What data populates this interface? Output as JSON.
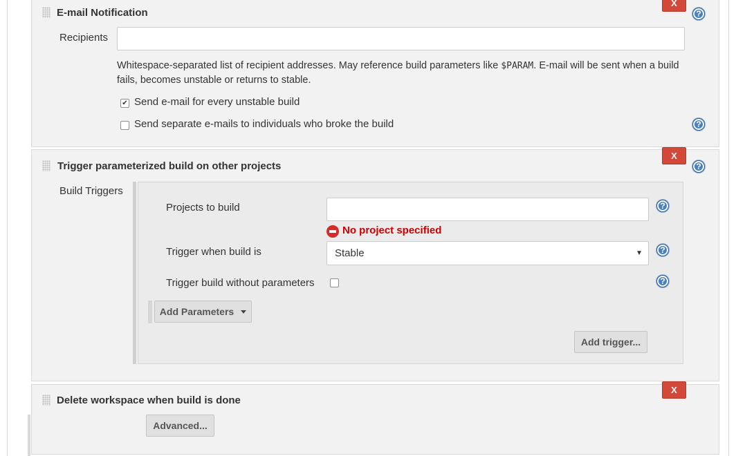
{
  "email_notification": {
    "title": "E-mail Notification",
    "delete_label": "X",
    "recipients_label": "Recipients",
    "recipients_value": "",
    "description_part1": "Whitespace-separated list of recipient addresses. May reference build parameters like ",
    "description_code": "$PARAM",
    "description_part2": ". E-mail will be sent when a build fails, becomes unstable or returns to stable.",
    "checkbox_unstable": {
      "label": "Send e-mail for every unstable build",
      "checked": true
    },
    "checkbox_individuals": {
      "label": "Send separate e-mails to individuals who broke the build",
      "checked": false
    }
  },
  "trigger_build": {
    "title": "Trigger parameterized build on other projects",
    "delete_label": "X",
    "build_triggers_label": "Build Triggers",
    "projects_label": "Projects to build",
    "projects_value": "",
    "error_text": "No project specified",
    "trigger_when_label": "Trigger when build is",
    "trigger_when_value": "Stable",
    "without_params_label": "Trigger build without parameters",
    "without_params_checked": false,
    "add_parameters_label": "Add Parameters",
    "add_trigger_label": "Add trigger..."
  },
  "delete_workspace": {
    "title": "Delete workspace when build is done",
    "delete_label": "X",
    "advanced_label": "Advanced..."
  },
  "help_glyph": "?",
  "colors": {
    "delete_button": "#d24939",
    "help_icon": "#4a7fc1",
    "error_text": "#cc0000",
    "panel_bg": "#f2f2f2"
  }
}
